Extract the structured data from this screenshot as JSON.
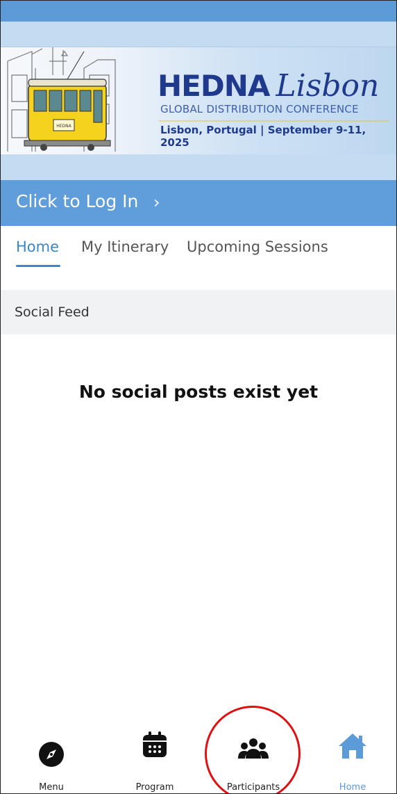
{
  "banner": {
    "brand": "HEDNA",
    "city_script": "Lisbon",
    "subtitle": "GLOBAL DISTRIBUTION CONFERENCE",
    "dateline": "Lisbon, Portugal | September 9-11, 2025",
    "tram_badge": "HEDNA"
  },
  "login": {
    "label": "Click to Log In",
    "chevron": "›"
  },
  "tabs": [
    {
      "label": "Home",
      "active": true
    },
    {
      "label": "My Itinerary",
      "active": false
    },
    {
      "label": "Upcoming Sessions",
      "active": false
    }
  ],
  "feed": {
    "header": "Social Feed",
    "empty_message": "No social posts exist yet"
  },
  "bottom_nav": [
    {
      "label": "Menu",
      "icon": "compass-icon",
      "active": false
    },
    {
      "label": "Program",
      "icon": "calendar-icon",
      "active": false
    },
    {
      "label": "Participants",
      "icon": "people-icon",
      "active": false
    },
    {
      "label": "Home",
      "icon": "house-icon",
      "active": true
    }
  ],
  "colors": {
    "accent": "#5f9ddb",
    "brand_navy": "#1f3a8c",
    "highlight_circle": "#e01010"
  }
}
